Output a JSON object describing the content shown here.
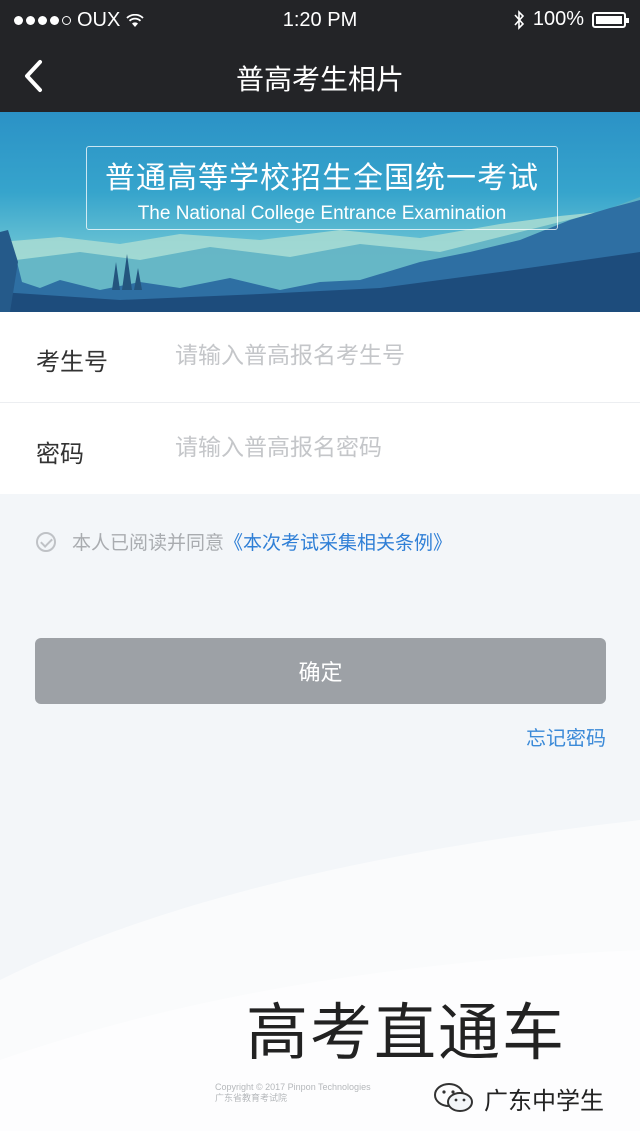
{
  "status_bar": {
    "carrier": "OUX",
    "time": "1:20 PM",
    "battery": "100%"
  },
  "nav": {
    "title": "普高考生相片"
  },
  "banner": {
    "title_cn": "普通高等学校招生全国统一考试",
    "title_en": "The National College Entrance Examination"
  },
  "form": {
    "exam_no_label": "考生号",
    "exam_no_placeholder": "请输入普高报名考生号",
    "password_label": "密码",
    "password_placeholder": "请输入普高报名密码"
  },
  "agreement": {
    "text": "本人已阅读并同意",
    "link": "《本次考试采集相关条例》"
  },
  "buttons": {
    "confirm": "确定",
    "forgot_password": "忘记密码"
  },
  "footer": {
    "copyright_line1": "Copyright © 2017 Pinpon Technologies",
    "copyright_line2": "广东省教育考试院",
    "watermark": "高考直通车",
    "brand": "广东中学生"
  },
  "colors": {
    "nav_bg": "#232427",
    "banner_sky": "#2b92c6",
    "link": "#2f7fd6",
    "button_bg": "#9da1a6"
  },
  "icons": [
    "signal-icon",
    "wifi-icon",
    "bluetooth-icon",
    "battery-icon",
    "back-arrow-icon",
    "checkbox-icon",
    "wechat-icon"
  ]
}
